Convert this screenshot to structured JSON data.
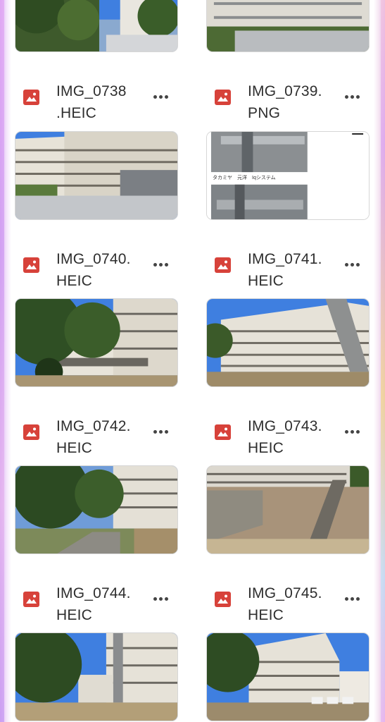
{
  "files": [
    {
      "name": "IMG_0738\n.HEIC",
      "type": "image"
    },
    {
      "name": "IMG_0739.\nPNG",
      "type": "image"
    },
    {
      "name": "IMG_0740.\nHEIC",
      "type": "image"
    },
    {
      "name": "IMG_0741.\nHEIC",
      "type": "image"
    },
    {
      "name": "IMG_0742.\nHEIC",
      "type": "image"
    },
    {
      "name": "IMG_0743.\nHEIC",
      "type": "image"
    },
    {
      "name": "IMG_0744.\nHEIC",
      "type": "image"
    },
    {
      "name": "IMG_0745.\nHEIC",
      "type": "image"
    }
  ],
  "png_preview_caption": "タカミヤ　元洋　Iqシステム",
  "icons": {
    "file_type": "image-file-icon",
    "more": "more-options-icon"
  },
  "colors": {
    "file_icon": "#d7423a",
    "sky": "#3f7fe0"
  }
}
